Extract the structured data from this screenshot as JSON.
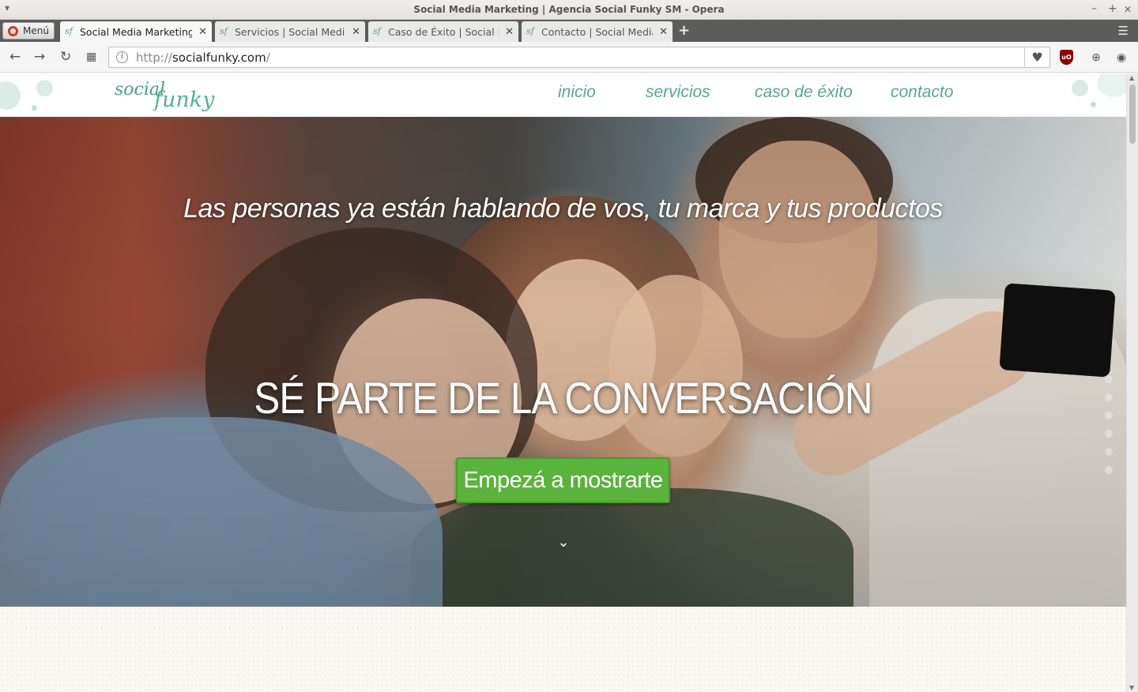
{
  "window": {
    "title": "Social Media Marketing | Agencia Social Funky SM - Opera",
    "minimize": "–",
    "maximize": "+",
    "close": "✕"
  },
  "browser": {
    "menu_label": "Menú",
    "tabs": [
      {
        "title": "Social Media Marketing",
        "active": true
      },
      {
        "title": "Servicios | Social Media",
        "active": false
      },
      {
        "title": "Caso de Éxito | Social M",
        "active": false
      },
      {
        "title": "Contacto | Social Media",
        "active": false
      }
    ],
    "tab_close": "✕",
    "new_tab": "+",
    "url": {
      "protocol": "http://",
      "host": "socialfunky.com",
      "path": "/"
    },
    "icons": {
      "back": "arrow-left-icon",
      "forward": "arrow-right-icon",
      "reload": "reload-icon",
      "speed_dial": "grid-icon",
      "site_info": "info-icon",
      "bookmark": "heart-icon",
      "ublock": "ublock-icon",
      "update": "update-icon",
      "profile": "user-icon"
    },
    "ublock_label": "uO"
  },
  "site": {
    "logo_word1": "social",
    "logo_word2": "funky",
    "nav": [
      "inicio",
      "servicios",
      "caso de éxito",
      "contacto"
    ],
    "accent_color": "#56a790",
    "hero": {
      "subtitle": "Las personas ya están hablando de vos, tu marca y tus productos",
      "title": "SÉ PARTE DE LA CONVERSACIÓN",
      "cta": "Empezá a mostrarte",
      "cta_color": "#5ab33d",
      "scroll_hint_icon": "chevron-down-icon"
    },
    "section_dots": 6
  }
}
